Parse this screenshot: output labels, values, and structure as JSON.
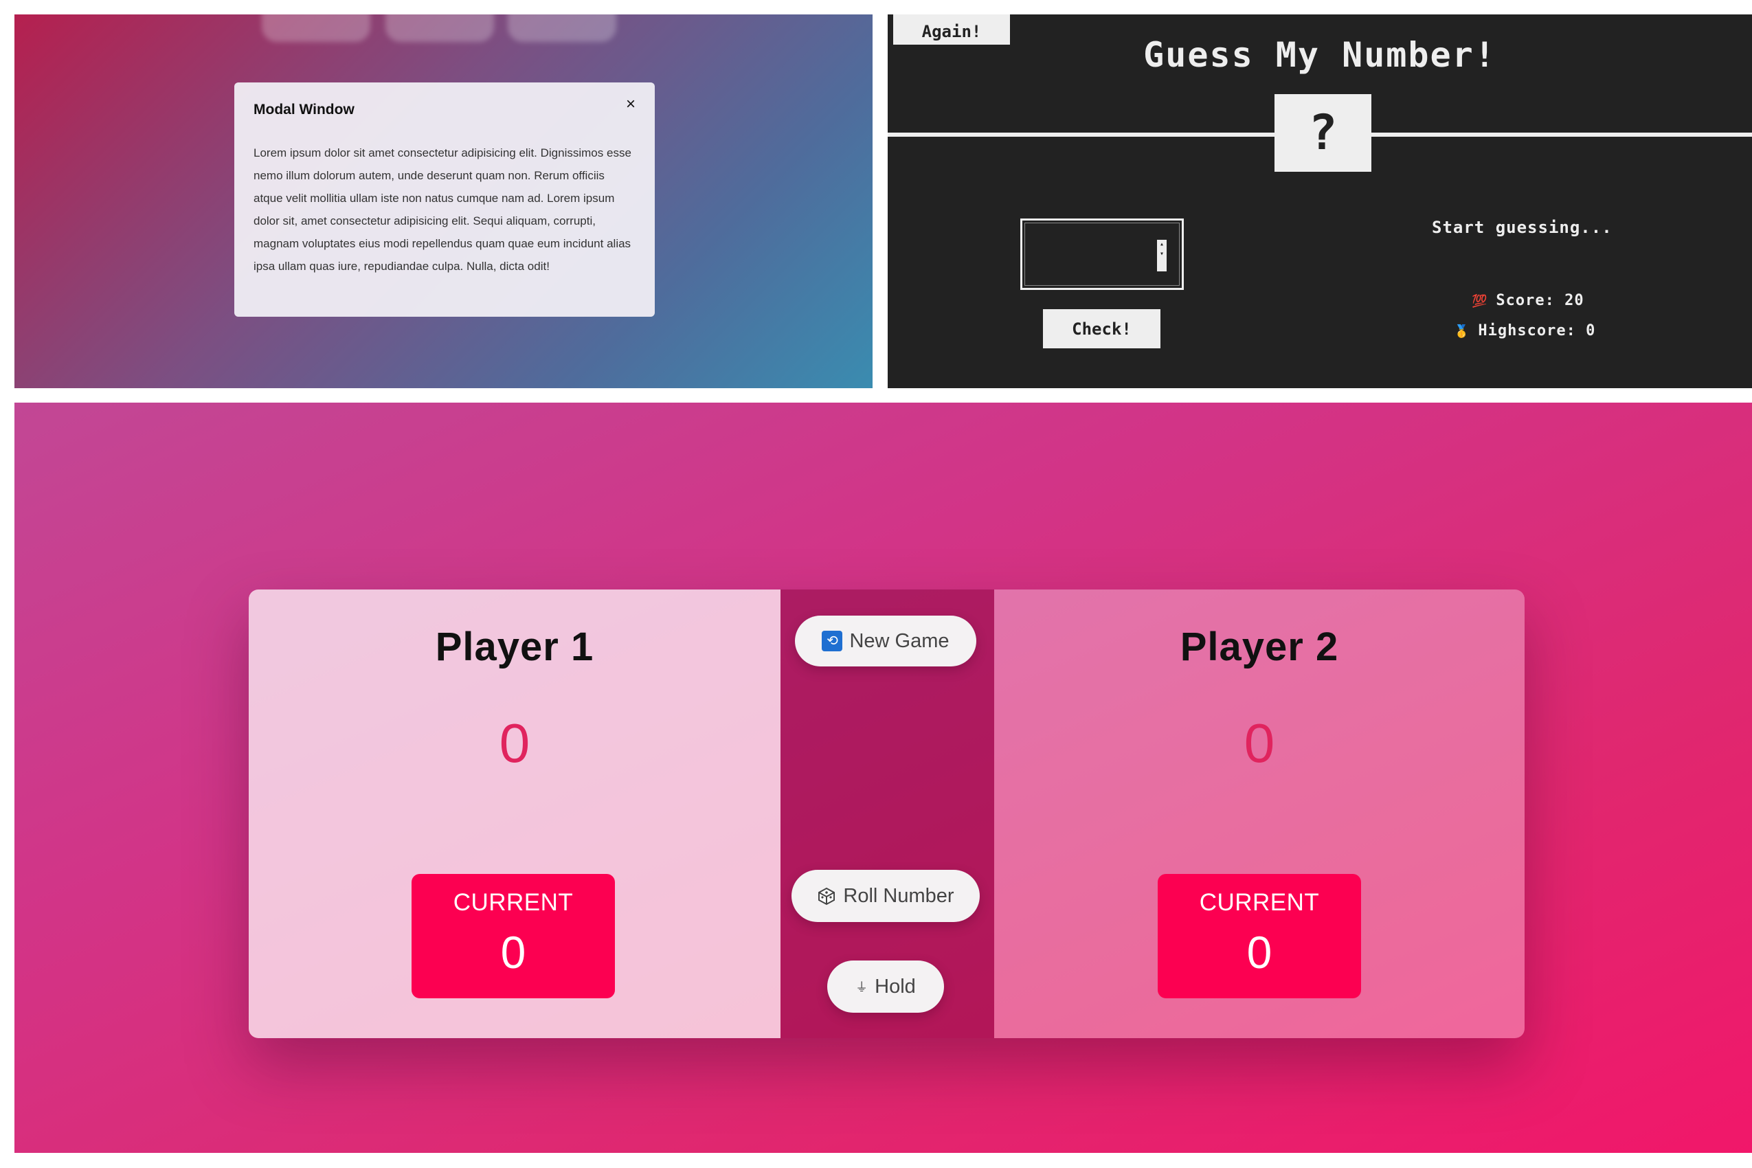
{
  "modal_panel": {
    "title": "Modal Window",
    "close_label": "×",
    "body": "Lorem ipsum dolor sit amet consectetur adipisicing elit. Dignissimos esse nemo illum dolorum autem, unde deserunt quam non. Rerum officiis atque velit mollitia ullam iste non natus cumque nam ad. Lorem ipsum dolor sit, amet consectetur adipisicing elit. Sequi aliquam, corrupti, magnam voluptates eius modi repellendus quam quae eum incidunt alias ipsa ullam quas iure, repudiandae culpa. Nulla, dicta odit!"
  },
  "guess_panel": {
    "again_label": "Again!",
    "title": "Guess My Number!",
    "secret": "?",
    "input_value": "",
    "check_label": "Check!",
    "message": "Start guessing...",
    "score_icon": "💯",
    "score_label": "Score: 20",
    "highscore_icon": "🥇",
    "highscore_label": "Highscore: 0",
    "score": 20,
    "highscore": 0
  },
  "pig_game": {
    "player1": {
      "name": "Player 1",
      "score": "0",
      "current_label": "CURRENT",
      "current": "0"
    },
    "player2": {
      "name": "Player 2",
      "score": "0",
      "current_label": "CURRENT",
      "current": "0"
    },
    "buttons": {
      "new_game": {
        "icon": "🔁",
        "label": "New Game"
      },
      "roll": {
        "icon": "dice-icon",
        "label": "Roll Number"
      },
      "hold": {
        "icon": "📥",
        "label": "Hold"
      }
    },
    "colors": {
      "accent": "#fc0051",
      "score": "#e0245e"
    }
  }
}
